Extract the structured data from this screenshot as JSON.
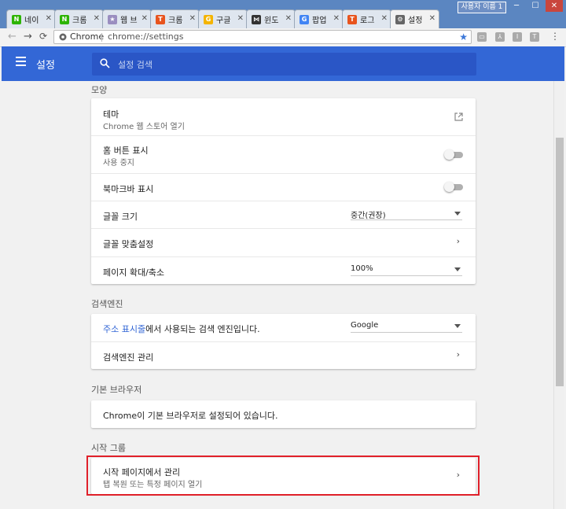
{
  "browser": {
    "tabs": [
      {
        "label": "네이",
        "icon": "naver-icon",
        "color": "#2db400",
        "glyph": "N"
      },
      {
        "label": "크롬",
        "icon": "naver-icon",
        "color": "#2db400",
        "glyph": "N"
      },
      {
        "label": "웹 브",
        "icon": "puzzle-icon",
        "color": "#9a8ec0",
        "glyph": "★"
      },
      {
        "label": "크롬",
        "icon": "tistory-icon",
        "color": "#e8541e",
        "glyph": "T"
      },
      {
        "label": "구글",
        "icon": "google-icon",
        "color": "#f4b400",
        "glyph": "G"
      },
      {
        "label": "윈도",
        "icon": "butterfly-icon",
        "color": "#333333",
        "glyph": "⋈"
      },
      {
        "label": "팝업",
        "icon": "google-icon",
        "color": "#4285f4",
        "glyph": "G"
      },
      {
        "label": "로그",
        "icon": "tistory-icon",
        "color": "#e8541e",
        "glyph": "T"
      },
      {
        "label": "설정",
        "icon": "gear-icon",
        "color": "#666666",
        "glyph": "⚙"
      }
    ],
    "active_tab": 8,
    "profile_label": "사용자 이름 1",
    "address": {
      "site_label": "Chrome",
      "url": "chrome://settings"
    }
  },
  "app": {
    "title": "설정",
    "search_placeholder": "설정 검색",
    "accent": "#3367d6"
  },
  "sections": {
    "appearance": {
      "title": "모양",
      "theme_label": "테마",
      "theme_sub": "Chrome 웹 스토어 열기",
      "home_label": "홈 버튼 표시",
      "home_sub": "사용 중지",
      "bookmarks_label": "북마크바 표시",
      "font_size_label": "글꼴 크기",
      "font_size_value": "중간(권장)",
      "font_custom_label": "글꼴 맞춤설정",
      "zoom_label": "페이지 확대/축소",
      "zoom_value": "100%"
    },
    "search_engine": {
      "title": "검색엔진",
      "used_link": "주소 표시줄",
      "used_rest": "에서 사용되는 검색 엔진입니다.",
      "engine_value": "Google",
      "manage_label": "검색엔진 관리"
    },
    "default_browser": {
      "title": "기본 브라우저",
      "status": "Chrome이 기본 브라우저로 설정되어 있습니다."
    },
    "startup": {
      "title": "시작 그룹",
      "pages_label": "시작 페이지에서 관리",
      "pages_sub": "탭 복원 또는 특정 페이지 열기"
    }
  }
}
